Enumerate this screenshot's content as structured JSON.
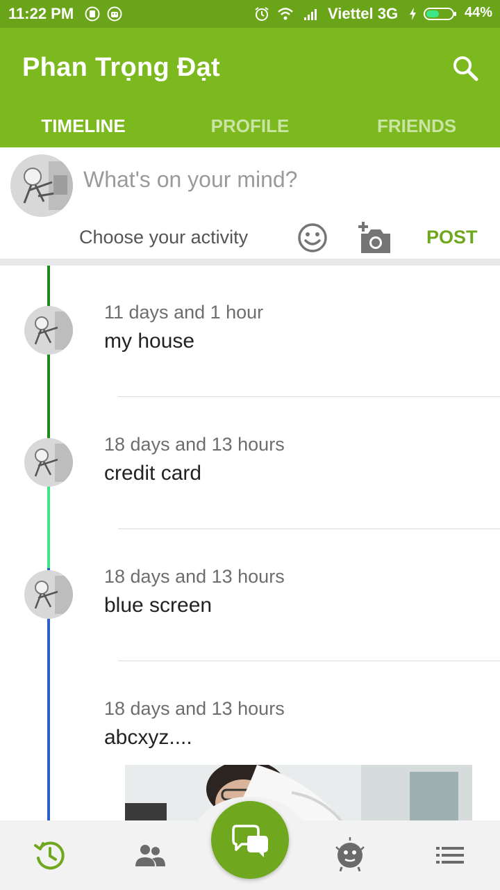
{
  "status_bar": {
    "time": "11:22 PM",
    "carrier": "Viettel 3G",
    "battery": "44%"
  },
  "app_bar": {
    "title": "Phan Trọng Đạt",
    "tabs": [
      {
        "label": "TIMELINE",
        "active": true
      },
      {
        "label": "PROFILE",
        "active": false
      },
      {
        "label": "FRIENDS",
        "active": false
      }
    ]
  },
  "composer": {
    "placeholder": "What's on your mind?",
    "activity_label": "Choose your activity",
    "post_label": "POST"
  },
  "timeline": {
    "entries": [
      {
        "time": "11 days and 1 hour",
        "text": "my house"
      },
      {
        "time": "18 days and 13 hours",
        "text": "credit card"
      },
      {
        "time": "18 days and 13 hours",
        "text": "blue screen"
      },
      {
        "time": "18 days and 13 hours",
        "text": "abcxyz...."
      }
    ]
  },
  "colors": {
    "status_bar": "#6aa419",
    "app_bar": "#7cb91f",
    "accent": "#6fa81e",
    "timeline_dark_green": "#1e8a1e",
    "timeline_light_green": "#3ee68a",
    "timeline_blue": "#2f5fc8"
  },
  "icons": {
    "status": [
      "sim-icon",
      "android-icon",
      "alarm-icon",
      "wifi-icon",
      "signal-icon",
      "charging-icon",
      "battery-icon"
    ],
    "app_bar": "search-icon",
    "composer": [
      "emoji-icon",
      "add-photo-icon"
    ],
    "bottom_nav": [
      "timeline-history-icon",
      "friends-icon",
      "chat-bubbles-icon",
      "emoji-face-icon",
      "list-menu-icon"
    ]
  }
}
